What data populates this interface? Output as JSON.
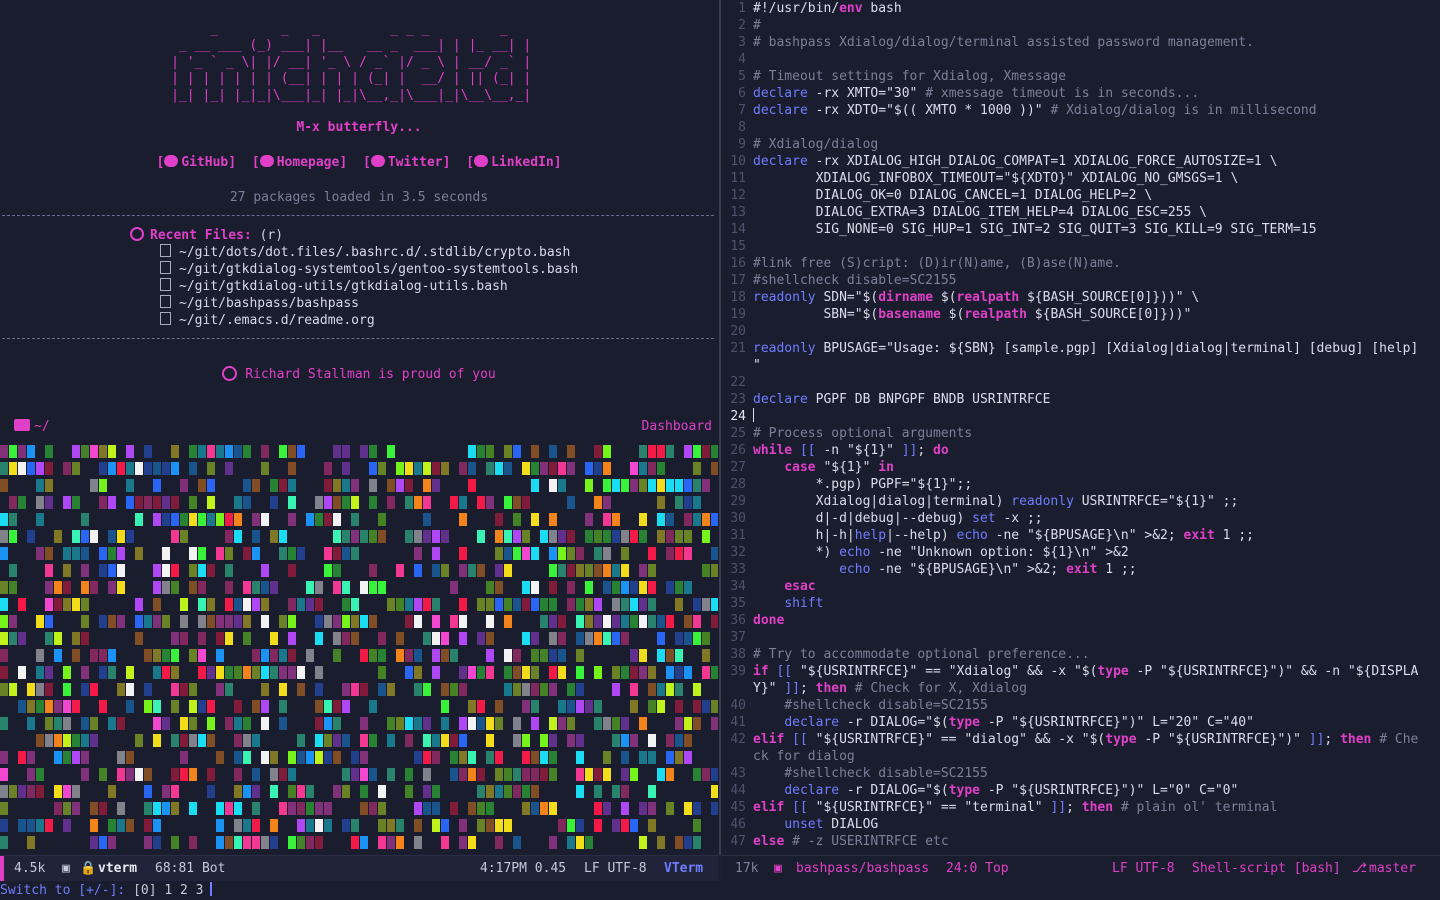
{
  "dashboard": {
    "banner": [
      "    _        _   _         _ _ _         _    ",
      " _ __ ___ (_) ___| |__   __ _  ___| | |_ __| |  ",
      "| '_ ` _ \\| |/ __| '_ \\ / _` |/ _ \\ | __/ _` |  ",
      "| | | | | | | (__| | | | (_| |  __/ | || (_| |  ",
      "|_| |_| |_|_|\\___|_| |_|\\__,_|\\___|_|\\__\\__,_|  "
    ],
    "subtitle": "M-x butterfly...",
    "links": [
      "[",
      "GitHub",
      "]",
      "[",
      "Homepage",
      "]",
      "[",
      "Twitter",
      "]",
      "[",
      "LinkedIn",
      "]"
    ],
    "link_labels": [
      "GitHub",
      "Homepage",
      "Twitter",
      "LinkedIn"
    ],
    "loaded": "27 packages loaded in 3.5 seconds",
    "recent_title": "Recent Files:",
    "recent_key": "(r)",
    "recent_files": [
      "~/git/dots/dot.files/.bashrc.d/.stdlib/crypto.bash",
      "~/git/gtkdialog-systemtools/gentoo-systemtools.bash",
      "~/git/gtkdialog-utils/gtkdialog-utils.bash",
      "~/git/bashpass/bashpass",
      "~/git/.emacs.d/readme.org"
    ],
    "quote": "Richard Stallman is proud of you",
    "directory": "~/",
    "buffer_label": "Dashboard"
  },
  "colors": {
    "accent": "#e040c8",
    "builtin": "#6f7dff",
    "background": "#1a1d2e",
    "comment": "#7b8099",
    "palette": [
      "#ff1a4a",
      "#ff8a1a",
      "#ffe81a",
      "#3aff3a",
      "#1ae8ff",
      "#2a6aff",
      "#b84aff",
      "#ff4ad8",
      "#ffffff",
      "#7aff1a",
      "#ff3a9a",
      "#3affb8",
      "#1a9aff",
      "#c8ff1a"
    ]
  },
  "code": [
    {
      "n": "1",
      "t": [
        [
          "sb",
          "#!/usr/bin/"
        ],
        [
          "fn",
          "env"
        ],
        [
          "sb",
          " bash"
        ]
      ]
    },
    {
      "n": "2",
      "t": [
        [
          "cm",
          "#"
        ]
      ]
    },
    {
      "n": "3",
      "t": [
        [
          "cm",
          "# bashpass Xdialog/dialog/terminal assisted password management."
        ]
      ]
    },
    {
      "n": "4",
      "t": []
    },
    {
      "n": "5",
      "t": [
        [
          "cm",
          "# Timeout settings for Xdialog, Xmessage"
        ]
      ]
    },
    {
      "n": "6",
      "t": [
        [
          "bi",
          "declare"
        ],
        [
          "var",
          " -rx XMTO="
        ],
        [
          "str",
          "\"30\""
        ],
        [
          "cm",
          " # xmessage timeout is in seconds..."
        ]
      ]
    },
    {
      "n": "7",
      "t": [
        [
          "bi",
          "declare"
        ],
        [
          "var",
          " -rx XDTO="
        ],
        [
          "str",
          "\"$(( XMTO * 1000 ))\""
        ],
        [
          "cm",
          " # Xdialog/dialog is in millisecond"
        ]
      ]
    },
    {
      "n": "8",
      "t": []
    },
    {
      "n": "9",
      "t": [
        [
          "cm",
          "# Xdialog/dialog"
        ]
      ]
    },
    {
      "n": "10",
      "t": [
        [
          "bi",
          "declare"
        ],
        [
          "var",
          " -rx XDIALOG_HIGH_DIALOG_COMPAT=1 XDIALOG_FORCE_AUTOSIZE=1 \\"
        ]
      ]
    },
    {
      "n": "11",
      "t": [
        [
          "var",
          "        XDIALOG_INFOBOX_TIMEOUT="
        ],
        [
          "str",
          "\"${XDTO}\""
        ],
        [
          "var",
          " XDIALOG_NO_GMSGS=1 \\"
        ]
      ]
    },
    {
      "n": "12",
      "t": [
        [
          "var",
          "        DIALOG_OK=0 DIALOG_CANCEL=1 DIALOG_HELP=2 \\"
        ]
      ]
    },
    {
      "n": "13",
      "t": [
        [
          "var",
          "        DIALOG_EXTRA=3 DIALOG_ITEM_HELP=4 DIALOG_ESC=255 \\"
        ]
      ]
    },
    {
      "n": "14",
      "t": [
        [
          "var",
          "        SIG_NONE=0 SIG_HUP=1 SIG_INT=2 SIG_QUIT=3 SIG_KILL=9 SIG_TERM=15"
        ]
      ]
    },
    {
      "n": "15",
      "t": []
    },
    {
      "n": "16",
      "t": [
        [
          "cm",
          "#link free (S)cript: (D)ir(N)ame, (B)ase(N)ame."
        ]
      ]
    },
    {
      "n": "17",
      "t": [
        [
          "cm",
          "#shellcheck disable=SC2155"
        ]
      ]
    },
    {
      "n": "18",
      "t": [
        [
          "bi",
          "readonly"
        ],
        [
          "var",
          " SDN="
        ],
        [
          "str",
          "\"$("
        ],
        [
          "fn",
          "dirname"
        ],
        [
          "str",
          " $("
        ],
        [
          "fn",
          "realpath"
        ],
        [
          "str",
          " ${BASH_SOURCE[0]}))\""
        ],
        [
          "var",
          " \\"
        ]
      ]
    },
    {
      "n": "19",
      "t": [
        [
          "var",
          "         SBN="
        ],
        [
          "str",
          "\"$("
        ],
        [
          "fn",
          "basename"
        ],
        [
          "str",
          " $("
        ],
        [
          "fn",
          "realpath"
        ],
        [
          "str",
          " ${BASH_SOURCE[0]}))\""
        ]
      ]
    },
    {
      "n": "20",
      "t": []
    },
    {
      "n": "21",
      "t": [
        [
          "bi",
          "readonly"
        ],
        [
          "var",
          " BPUSAGE="
        ],
        [
          "str",
          "\"Usage: ${SBN} [sample.pgp] [Xdialog|dialog|terminal] [debug] [help]"
        ]
      ]
    },
    {
      "n": "",
      "t": [
        [
          "str",
          "\""
        ]
      ]
    },
    {
      "n": "22",
      "t": []
    },
    {
      "n": "23",
      "t": [
        [
          "bi",
          "declare"
        ],
        [
          "var",
          " PGPF DB BNPGPF BNDB USRINTRFCE"
        ]
      ]
    },
    {
      "n": "24",
      "t": [
        [
          "cur",
          ""
        ]
      ],
      "cur": true
    },
    {
      "n": "25",
      "t": [
        [
          "cm",
          "# Process optional arguments"
        ]
      ]
    },
    {
      "n": "26",
      "t": [
        [
          "kw",
          "while"
        ],
        [
          "var",
          " "
        ],
        [
          "bi",
          "[["
        ],
        [
          "var",
          " -n "
        ],
        [
          "str",
          "\"${1}\""
        ],
        [
          "var",
          " "
        ],
        [
          "bi",
          "]]"
        ],
        [
          "var",
          "; "
        ],
        [
          "kw",
          "do"
        ]
      ]
    },
    {
      "n": "27",
      "t": [
        [
          "var",
          "    "
        ],
        [
          "kw",
          "case"
        ],
        [
          "var",
          " "
        ],
        [
          "str",
          "\"${1}\""
        ],
        [
          "var",
          " "
        ],
        [
          "kw",
          "in"
        ]
      ]
    },
    {
      "n": "28",
      "t": [
        [
          "var",
          "        *.pgp) PGPF="
        ],
        [
          "str",
          "\"${1}\""
        ],
        [
          "var",
          ";;"
        ]
      ]
    },
    {
      "n": "29",
      "t": [
        [
          "var",
          "        Xdialog|dialog|terminal) "
        ],
        [
          "bi",
          "readonly"
        ],
        [
          "var",
          " USRINTRFCE="
        ],
        [
          "str",
          "\"${1}\""
        ],
        [
          "var",
          " ;;"
        ]
      ]
    },
    {
      "n": "30",
      "t": [
        [
          "var",
          "        d|-d|debug|--debug) "
        ],
        [
          "bi",
          "set"
        ],
        [
          "var",
          " -x ;;"
        ]
      ]
    },
    {
      "n": "31",
      "t": [
        [
          "var",
          "        h|-h|"
        ],
        [
          "bi",
          "help"
        ],
        [
          "var",
          "|--help) "
        ],
        [
          "bi",
          "echo"
        ],
        [
          "var",
          " -ne "
        ],
        [
          "str",
          "\"${BPUSAGE}\\n\""
        ],
        [
          "var",
          " >&2; "
        ],
        [
          "kw",
          "exit"
        ],
        [
          "var",
          " 1 ;;"
        ]
      ]
    },
    {
      "n": "32",
      "t": [
        [
          "var",
          "        *) "
        ],
        [
          "bi",
          "echo"
        ],
        [
          "var",
          " -ne "
        ],
        [
          "str",
          "\"Unknown option: ${1}\\n\""
        ],
        [
          "var",
          " >&2"
        ]
      ]
    },
    {
      "n": "33",
      "t": [
        [
          "var",
          "           "
        ],
        [
          "bi",
          "echo"
        ],
        [
          "var",
          " -ne "
        ],
        [
          "str",
          "\"${BPUSAGE}\\n\""
        ],
        [
          "var",
          " >&2; "
        ],
        [
          "kw",
          "exit"
        ],
        [
          "var",
          " 1 ;;"
        ]
      ]
    },
    {
      "n": "34",
      "t": [
        [
          "var",
          "    "
        ],
        [
          "kw",
          "esac"
        ]
      ]
    },
    {
      "n": "35",
      "t": [
        [
          "var",
          "    "
        ],
        [
          "bi",
          "shift"
        ]
      ]
    },
    {
      "n": "36",
      "t": [
        [
          "kw",
          "done"
        ]
      ]
    },
    {
      "n": "37",
      "t": []
    },
    {
      "n": "38",
      "t": [
        [
          "cm",
          "# Try to accommodate optional preference..."
        ]
      ]
    },
    {
      "n": "39",
      "t": [
        [
          "kw",
          "if"
        ],
        [
          "var",
          " "
        ],
        [
          "bi",
          "[["
        ],
        [
          "var",
          " "
        ],
        [
          "str",
          "\"${USRINTRFCE}\""
        ],
        [
          "var",
          " == "
        ],
        [
          "str",
          "\"Xdialog\""
        ],
        [
          "var",
          " && -x "
        ],
        [
          "str",
          "\"$("
        ],
        [
          "fn",
          "type"
        ],
        [
          "str",
          " -P \"${USRINTRFCE}\")\""
        ],
        [
          "var",
          " && -n "
        ],
        [
          "str",
          "\"${DISPLA"
        ]
      ]
    },
    {
      "n": "",
      "t": [
        [
          "str",
          "Y}\""
        ],
        [
          "var",
          " "
        ],
        [
          "bi",
          "]]"
        ],
        [
          "var",
          "; "
        ],
        [
          "kw",
          "then"
        ],
        [
          "cm",
          " # Check for X, Xdialog"
        ]
      ]
    },
    {
      "n": "40",
      "t": [
        [
          "cm",
          "    #shellcheck disable=SC2155"
        ]
      ]
    },
    {
      "n": "41",
      "t": [
        [
          "var",
          "    "
        ],
        [
          "bi",
          "declare"
        ],
        [
          "var",
          " -r DIALOG="
        ],
        [
          "str",
          "\"$("
        ],
        [
          "fn",
          "type"
        ],
        [
          "str",
          " -P \"${USRINTRFCE}\")\""
        ],
        [
          "var",
          " L="
        ],
        [
          "str",
          "\"20\""
        ],
        [
          "var",
          " C="
        ],
        [
          "str",
          "\"40\""
        ]
      ]
    },
    {
      "n": "42",
      "t": [
        [
          "kw",
          "elif"
        ],
        [
          "var",
          " "
        ],
        [
          "bi",
          "[["
        ],
        [
          "var",
          " "
        ],
        [
          "str",
          "\"${USRINTRFCE}\""
        ],
        [
          "var",
          " == "
        ],
        [
          "str",
          "\"dialog\""
        ],
        [
          "var",
          " && -x "
        ],
        [
          "str",
          "\"$("
        ],
        [
          "fn",
          "type"
        ],
        [
          "str",
          " -P \"${USRINTRFCE}\")\""
        ],
        [
          "var",
          " "
        ],
        [
          "bi",
          "]]"
        ],
        [
          "var",
          "; "
        ],
        [
          "kw",
          "then"
        ],
        [
          "cm",
          " # Che"
        ]
      ]
    },
    {
      "n": "",
      "t": [
        [
          "cm",
          "ck for dialog"
        ]
      ]
    },
    {
      "n": "43",
      "t": [
        [
          "cm",
          "    #shellcheck disable=SC2155"
        ]
      ]
    },
    {
      "n": "44",
      "t": [
        [
          "var",
          "    "
        ],
        [
          "bi",
          "declare"
        ],
        [
          "var",
          " -r DIALOG="
        ],
        [
          "str",
          "\"$("
        ],
        [
          "fn",
          "type"
        ],
        [
          "str",
          " -P \"${USRINTRFCE}\")\""
        ],
        [
          "var",
          " L="
        ],
        [
          "str",
          "\"0\""
        ],
        [
          "var",
          " C="
        ],
        [
          "str",
          "\"0\""
        ]
      ]
    },
    {
      "n": "45",
      "t": [
        [
          "kw",
          "elif"
        ],
        [
          "var",
          " "
        ],
        [
          "bi",
          "[["
        ],
        [
          "var",
          " "
        ],
        [
          "str",
          "\"${USRINTRFCE}\""
        ],
        [
          "var",
          " == "
        ],
        [
          "str",
          "\"terminal\""
        ],
        [
          "var",
          " "
        ],
        [
          "bi",
          "]]"
        ],
        [
          "var",
          "; "
        ],
        [
          "kw",
          "then"
        ],
        [
          "cm",
          " # plain ol' terminal"
        ]
      ]
    },
    {
      "n": "46",
      "t": [
        [
          "var",
          "    "
        ],
        [
          "bi",
          "unset"
        ],
        [
          "var",
          " DIALOG"
        ]
      ]
    },
    {
      "n": "47",
      "t": [
        [
          "kw",
          "else"
        ],
        [
          "cm",
          " # -z USERINTRFCE etc"
        ]
      ]
    }
  ],
  "modeline_left": {
    "size": "4.5k",
    "buffer": "vterm",
    "position": "68:81 Bot",
    "time": "4:17PM 0.45",
    "encoding": "LF UTF-8",
    "mode": "VTerm"
  },
  "modeline_right": {
    "size": "17k",
    "buffer": "bashpass/bashpass",
    "position": "24:0 Top",
    "encoding": "LF UTF-8",
    "mode": "Shell-script [bash]",
    "branch": "master"
  },
  "echo": {
    "prompt": "Switch to [+/-]:",
    "workspaces": "[0] 1  2  3"
  }
}
